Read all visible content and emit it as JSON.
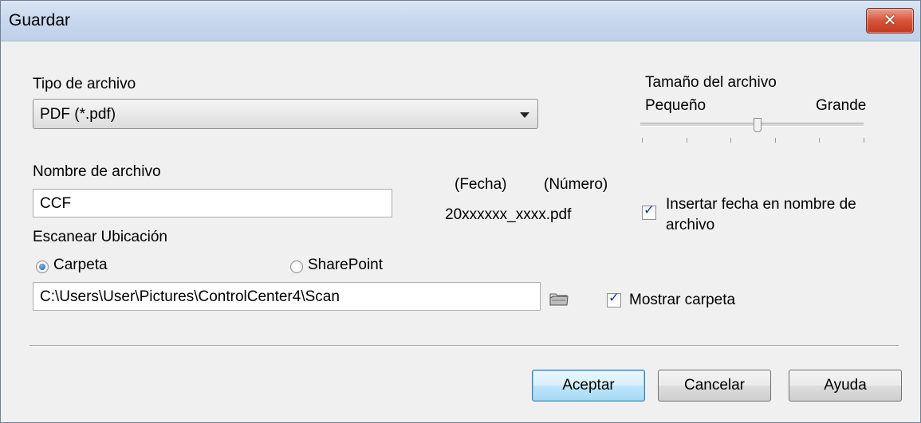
{
  "window": {
    "title": "Guardar",
    "close_label": "✕"
  },
  "file_type": {
    "label": "Tipo de archivo",
    "selected": "PDF (*.pdf)"
  },
  "file_size": {
    "label": "Tamaño del archivo",
    "min_label": "Pequeño",
    "max_label": "Grande",
    "level_fraction": 0.52,
    "tick_count": 6
  },
  "file_name": {
    "label": "Nombre de archivo",
    "value": "CCF"
  },
  "name_preview": {
    "date_label": "(Fecha)",
    "number_label": "(Número)",
    "example": "20xxxxxx_xxxx.pdf"
  },
  "insert_date": {
    "checked": true,
    "label_line1": "Insertar fecha en nombre de",
    "label_line2": "archivo"
  },
  "scan_location": {
    "label": "Escanear Ubicación",
    "option_folder": "Carpeta",
    "option_sharepoint": "SharePoint",
    "selected": "folder",
    "path": "C:\\Users\\User\\Pictures\\ControlCenter4\\Scan"
  },
  "show_folder": {
    "checked": true,
    "label": "Mostrar carpeta"
  },
  "buttons": {
    "ok": "Aceptar",
    "cancel": "Cancelar",
    "help": "Ayuda"
  }
}
